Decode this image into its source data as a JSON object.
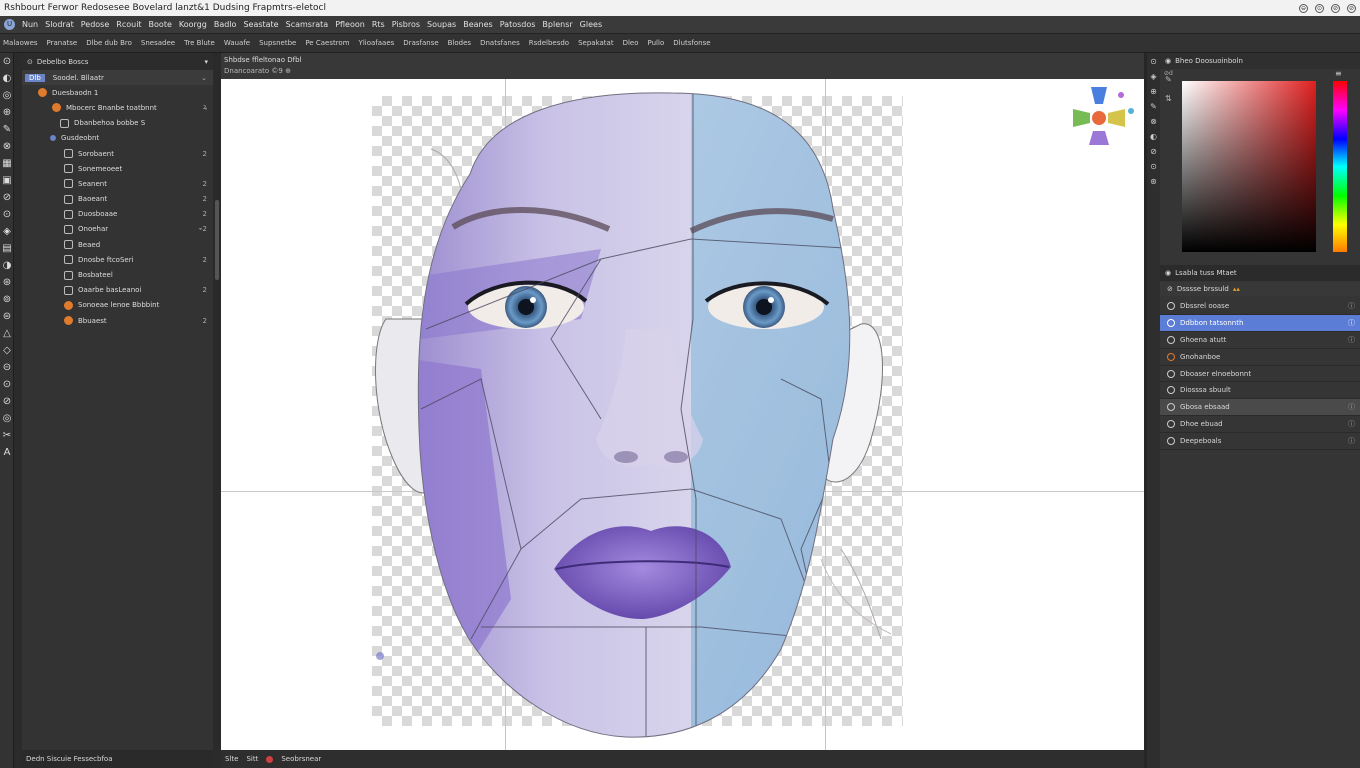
{
  "window": {
    "title": "Rshbourt Ferwor Redosesee Bovelard lanzt&1 Dudsing Frapmtrs-eletocl",
    "controls": [
      "⊖",
      "⊙",
      "⊘",
      "⊘"
    ]
  },
  "menubar": {
    "logo": "U",
    "items": [
      "Nun",
      "Slodrat",
      "Pedose",
      "Rcouit",
      "Boote",
      "Koorgg",
      "Badlo",
      "Seastate",
      "Scamsrata",
      "Pfleoon",
      "Rts",
      "Pisbros",
      "Soupas",
      "Beanes",
      "Patosdos",
      "Bplensr",
      "Glees"
    ]
  },
  "optionsbar": {
    "items": [
      "Malaowes",
      "Pranatse",
      "Dlbe dub Bro",
      "Snesadee",
      "Tre Blute",
      "Wauafe",
      "Supsnetbe",
      "Pe Caestrom",
      "Ylioafaaes",
      "Drasfanse",
      "Blodes",
      "Dnatsfanes",
      "Rsdelbesdo",
      "Sepakatat",
      "Dleo",
      "Pullo",
      "Dlutsfonse"
    ]
  },
  "tools": [
    "⊙",
    "◐",
    "◎",
    "⊕",
    "✎",
    "⊗",
    "▦",
    "▣",
    "⊘",
    "⊙",
    "◈",
    "▤",
    "◑",
    "⊛",
    "⊚",
    "⊜",
    "△",
    "◇",
    "⊝",
    "⊙",
    "⊘",
    "◎",
    "✂",
    "A"
  ],
  "leftpanel": {
    "title": "Debelbo Boscs",
    "tab": "Dlb",
    "group": "Soodel. Bllaatr",
    "rows": [
      {
        "label": "Duesbaodn 1",
        "tag": ""
      },
      {
        "label": "Mbocerc Bnanbe toatbnnt",
        "tag": "ꝝ"
      },
      {
        "label": "Dbanbehoa bobbe S",
        "tag": ""
      },
      {
        "label": "Gusdeobnt",
        "tag": ""
      },
      {
        "label": "Sorobaent",
        "tag": "2"
      },
      {
        "label": "Sonemeoeet",
        "tag": ""
      },
      {
        "label": "Seanent",
        "tag": "2"
      },
      {
        "label": "Baoeant",
        "tag": "2"
      },
      {
        "label": "Duosboaae",
        "tag": "2"
      },
      {
        "label": "Onoehar",
        "tag": "⌁2"
      },
      {
        "label": "Beaed",
        "tag": ""
      },
      {
        "label": "Dnosbe ftcoSeri",
        "tag": "2"
      },
      {
        "label": "Bosbateel",
        "tag": ""
      },
      {
        "label": "Oaarbe basLeanoi",
        "tag": "2"
      },
      {
        "label": "Sonoeae lenoe Bbbbint",
        "tag": ""
      },
      {
        "label": "Bbuaest",
        "tag": "2"
      }
    ],
    "status": "Dedn Siscuie Fessecbfoa"
  },
  "document": {
    "tab_title": "Shbdse ffleltonao Dfbl",
    "tab_sub": "Dnancoarato ©9 ⊕"
  },
  "canvas_status": {
    "items": [
      "Slte",
      "Sitt",
      "Seobrsnear"
    ]
  },
  "rightpanel": {
    "color_title": "Bheo Doosuoinboln",
    "swatch_label": "⊘d",
    "layers_title": "Lsabla tuss Mtaet",
    "layers_sub": "Dsssse brssuld",
    "layers": [
      {
        "label": "Dbssrel ooase",
        "end": "ⓘ"
      },
      {
        "label": "Ddbbon tatsonnth",
        "end": "ⓘ"
      },
      {
        "label": "Ghoena atutt",
        "end": "ⓘ"
      },
      {
        "label": "Gnohanboe",
        "end": ""
      },
      {
        "label": "Dboaser elnoebonnt",
        "end": ""
      },
      {
        "label": "Diosssa sbuult",
        "end": ""
      },
      {
        "label": "Gbosa ebsaad",
        "end": "ⓘ"
      },
      {
        "label": "Dhoe ebuad",
        "end": "ⓘ"
      },
      {
        "label": "Deepeboals",
        "end": "ⓘ"
      }
    ],
    "strip_icons": [
      "⊙",
      "◈",
      "⊕",
      "✎",
      "⊗",
      "◐",
      "⊘",
      "⊙",
      "⊛"
    ]
  },
  "colors": {
    "selection": "#5b7dd6",
    "accent_orange": "#e07b2c",
    "face_lavender": "#a898d6",
    "face_blue": "#9ec0dd",
    "lips": "#7c5cc4",
    "iris": "#5d88b8"
  }
}
